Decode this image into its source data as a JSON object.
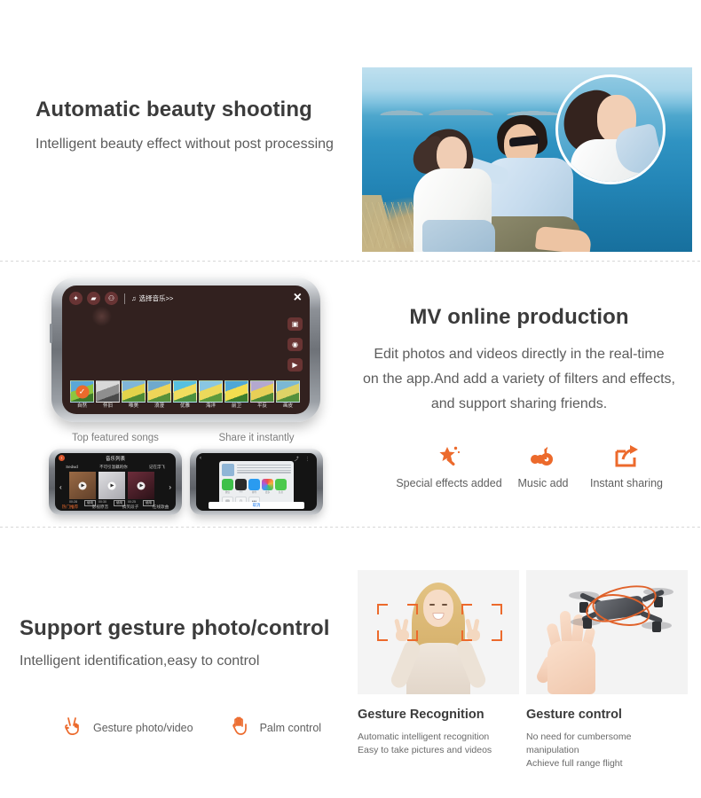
{
  "theme": {
    "accent": "#ec6a2c",
    "title_color": "#3b3b3b",
    "body_color": "#5c5c5c"
  },
  "section1": {
    "title": "Automatic beauty shooting",
    "subtitle": "Intelligent beauty effect without post processing"
  },
  "section2": {
    "title": "MV online production",
    "line1": "Edit photos and videos directly in the real-time",
    "line2": "on the app.And add a variety of filters and effects,",
    "line3": "and support sharing friends.",
    "features": [
      {
        "icon": "magic-wand-icon",
        "label": "Special effects added"
      },
      {
        "icon": "music-note-icon",
        "label": "Music add"
      },
      {
        "icon": "share-arrow-icon",
        "label": "Instant sharing"
      }
    ],
    "phone_big": {
      "toolbar_icons": [
        "magic-wand-icon",
        "folder-icon",
        "robot-icon"
      ],
      "music_icon": "music-note-icon",
      "music_label": "选择音乐>>",
      "close_label": "×",
      "side_icons": [
        "switch-camera-icon",
        "camera-icon",
        "video-icon"
      ],
      "filters": [
        {
          "label": "自然",
          "selected": true
        },
        {
          "label": "怀旧",
          "selected": false
        },
        {
          "label": "唯美",
          "selected": false
        },
        {
          "label": "浪漫",
          "selected": false
        },
        {
          "label": "优雅",
          "selected": false
        },
        {
          "label": "海洋",
          "selected": false
        },
        {
          "label": "前卫",
          "selected": false
        },
        {
          "label": "平反",
          "selected": false
        },
        {
          "label": "画皮",
          "selected": false
        }
      ]
    },
    "mini_left": {
      "caption": "Top featured songs",
      "screen_title": "音乐列表",
      "tabs": [
        "Sedwd",
        "不可引温藕的你",
        "记在浮飞"
      ],
      "bottom_tabs": [
        "热门推荐",
        "影视原音",
        "搞笑段子",
        "在线歌曲"
      ],
      "card_times": [
        "00:28",
        "00:30",
        "00:25"
      ],
      "card_action": "使用"
    },
    "mini_right": {
      "caption": "Share it instantly",
      "apps": [
        "微信",
        "QQ",
        "邮件",
        "更多",
        "信息"
      ],
      "cancel_label": "取消"
    }
  },
  "section3": {
    "title": "Support gesture photo/control",
    "subtitle": "Intelligent identification,easy to control",
    "gestures": [
      {
        "icon": "victory-hand-icon",
        "label": "Gesture photo/video"
      },
      {
        "icon": "open-palm-icon",
        "label": "Palm control"
      }
    ],
    "cards": [
      {
        "title": "Gesture Recognition",
        "line1": "Automatic intelligent recognition",
        "line2": "Easy to take pictures and videos"
      },
      {
        "title": "Gesture control",
        "line1": "No need for cumbersome manipulation",
        "line2": "Achieve full range flight"
      }
    ]
  }
}
